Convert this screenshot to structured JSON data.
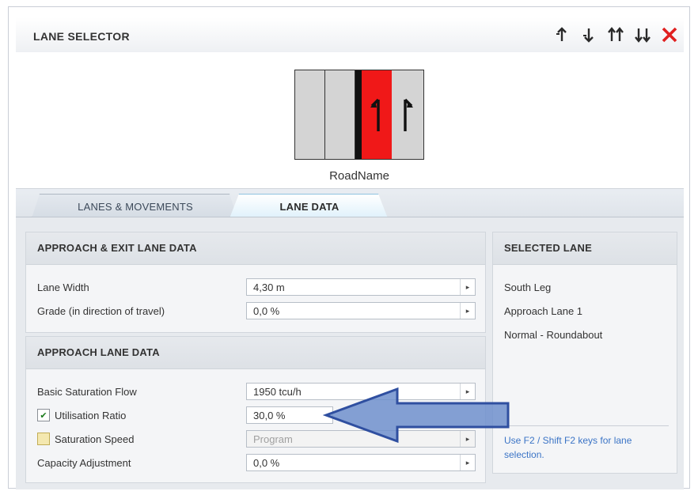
{
  "header": {
    "title": "LANE SELECTOR",
    "tools": [
      {
        "name": "move-up-icon",
        "glyph": "↑"
      },
      {
        "name": "move-down-icon",
        "glyph": "↓"
      },
      {
        "name": "move-top-icon",
        "glyph": "↑↑"
      },
      {
        "name": "move-bottom-icon",
        "glyph": "↓↓"
      },
      {
        "name": "delete-icon",
        "glyph": "✕"
      }
    ]
  },
  "diagram": {
    "road_name": "RoadName",
    "lane_colors": {
      "grey": "#d4d4d4",
      "selected": "#f01818",
      "median": "#111111"
    }
  },
  "tabs": [
    {
      "label": "LANES & MOVEMENTS",
      "active": false
    },
    {
      "label": "LANE DATA",
      "active": true
    }
  ],
  "approach_exit": {
    "title": "APPROACH & EXIT LANE DATA",
    "rows": [
      {
        "label": "Lane Width",
        "value": "4,30 m"
      },
      {
        "label": "Grade (in direction of travel)",
        "value": "0,0 %"
      }
    ]
  },
  "approach": {
    "title": "APPROACH LANE DATA",
    "rows": [
      {
        "label": "Basic Saturation Flow",
        "value": "1950 tcu/h",
        "checkbox": null
      },
      {
        "label": "Utilisation Ratio",
        "value": "30,0 %",
        "checkbox": true
      },
      {
        "label": "Saturation Speed",
        "value": "Program",
        "checkbox": false
      },
      {
        "label": "Capacity Adjustment",
        "value": "0,0 %",
        "checkbox": null
      }
    ]
  },
  "selected_lane": {
    "title": "SELECTED LANE",
    "lines": [
      "South Leg",
      "Approach Lane 1",
      "Normal - Roundabout"
    ],
    "hint": "Use F2 / Shift F2 keys for lane selection."
  },
  "accent": {
    "callout_arrow": "#5b7fc0",
    "hint_text": "#3b74c6"
  }
}
